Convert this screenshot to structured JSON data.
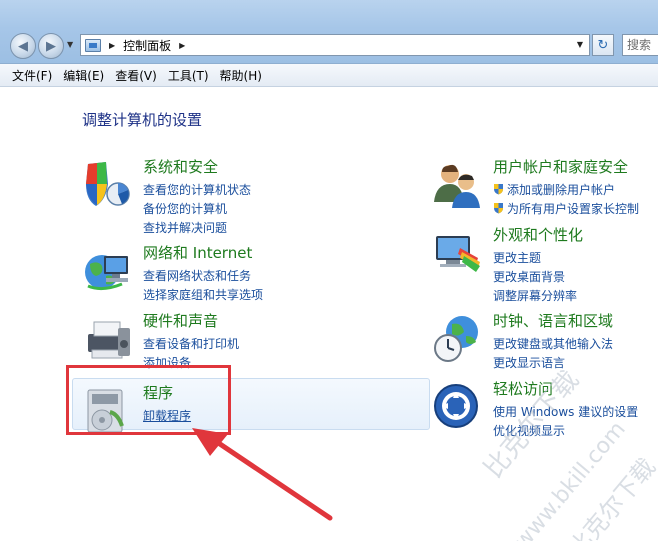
{
  "toolbar": {
    "back_icon": "back-arrow-icon",
    "forward_icon": "forward-arrow-icon",
    "address_path": "控制面板",
    "search_placeholder": "搜索"
  },
  "menu": [
    "文件(F)",
    "编辑(E)",
    "查看(V)",
    "工具(T)",
    "帮助(H)"
  ],
  "page": {
    "title": "调整计算机的设置"
  },
  "categories": {
    "system": {
      "icon": "shield-chart-icon",
      "title": "系统和安全",
      "links": [
        "查看您的计算机状态",
        "备份您的计算机",
        "查找并解决问题"
      ]
    },
    "network": {
      "icon": "globe-network-icon",
      "title": "网络和 Internet",
      "links": [
        "查看网络状态和任务",
        "选择家庭组和共享选项"
      ]
    },
    "hardware": {
      "icon": "printer-icon",
      "title": "硬件和声音",
      "links": [
        "查看设备和打印机",
        "添加设备"
      ]
    },
    "programs": {
      "icon": "programs-box-icon",
      "title": "程序",
      "links": [
        "卸载程序"
      ]
    },
    "users": {
      "icon": "users-icon",
      "title": "用户帐户和家庭安全",
      "links": [
        "添加或删除用户帐户",
        "为所有用户设置家长控制"
      ]
    },
    "appearance": {
      "icon": "monitor-palette-icon",
      "title": "外观和个性化",
      "links": [
        "更改主题",
        "更改桌面背景",
        "调整屏幕分辨率"
      ]
    },
    "clock": {
      "icon": "clock-globe-icon",
      "title": "时钟、语言和区域",
      "links": [
        "更改键盘或其他输入法",
        "更改显示语言"
      ]
    },
    "ease": {
      "icon": "ease-of-access-icon",
      "title": "轻松访问",
      "links": [
        "使用 Windows 建议的设置",
        "优化视频显示"
      ]
    }
  },
  "colors": {
    "category_title": "#1e7a1e",
    "link": "#1a4e9c",
    "heading": "#1e3287",
    "annotation_red": "#e0363c"
  },
  "watermark": [
    "比克尔下载",
    "www.bkill.com",
    "比克尔下载"
  ]
}
